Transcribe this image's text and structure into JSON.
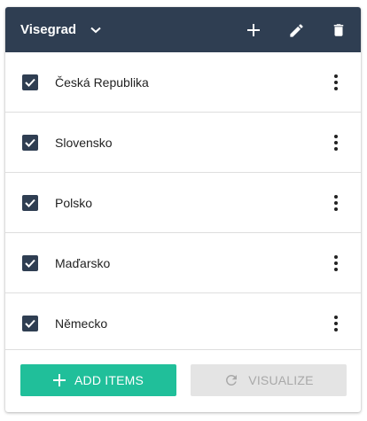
{
  "header": {
    "title": "Visegrad"
  },
  "items": [
    {
      "label": "Česká Republika",
      "checked": true
    },
    {
      "label": "Slovensko",
      "checked": true
    },
    {
      "label": "Polsko",
      "checked": true
    },
    {
      "label": "Maďarsko",
      "checked": true
    },
    {
      "label": "Německo",
      "checked": true
    }
  ],
  "footer": {
    "add_label": "ADD ITEMS",
    "visualize_label": "VISUALIZE"
  },
  "colors": {
    "header_bg": "#2f3e52",
    "checkbox": "#2f3e52",
    "add_button": "#20bf9a",
    "visualize_disabled_bg": "#e4e4e4",
    "visualize_disabled_text": "#a9a9a9"
  },
  "icons": [
    "chevron-down-icon",
    "plus-icon",
    "pencil-icon",
    "trash-icon",
    "checkmark-icon",
    "more-vert-icon",
    "refresh-icon"
  ]
}
